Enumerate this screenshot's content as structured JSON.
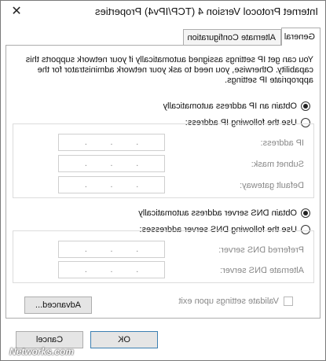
{
  "window": {
    "title": "Internet Protocol Version 4 (TCP/IPv4) Properties",
    "close_glyph": "✕"
  },
  "tabs": [
    {
      "label": "General",
      "selected": true
    },
    {
      "label": "Alternate Configuration",
      "selected": false
    }
  ],
  "description": "You can get IP settings assigned automatically if your network supports this capability. Otherwise, you need to ask your network administrator for the appropriate IP settings.",
  "ip": {
    "auto_label": "Obtain an IP address automatically",
    "manual_label": "Use the following IP address:",
    "selected": "auto",
    "fields": [
      {
        "label": "IP address:"
      },
      {
        "label": "Subnet mask:"
      },
      {
        "label": "Default gateway:"
      }
    ]
  },
  "dns": {
    "auto_label": "Obtain DNS server address automatically",
    "manual_label": "Use the following DNS server addresses:",
    "selected": "auto",
    "fields": [
      {
        "label": "Preferred DNS server:"
      },
      {
        "label": "Alternate DNS server:"
      }
    ]
  },
  "octet_separator": ".",
  "validate": {
    "label": "Validate settings upon exit",
    "checked": false
  },
  "buttons": {
    "advanced": "Advanced...",
    "ok": "OK",
    "cancel": "Cancel"
  },
  "watermark": "Networks.com",
  "colors": {
    "accent": "#3c7fb1",
    "border": "#adadad",
    "disabled_text": "#888888"
  }
}
